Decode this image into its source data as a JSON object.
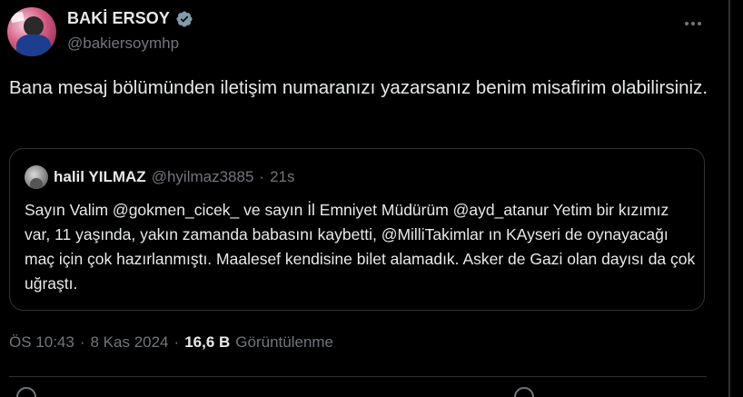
{
  "author": {
    "display_name": "BAKİ ERSOY",
    "handle": "@bakiersoymhp",
    "verified": true
  },
  "tweet": {
    "text": "Bana mesaj bölümünden iletişim numaranızı yazarsanız benim misafirim olabilirsiniz."
  },
  "quoted_tweet": {
    "display_name": "halil YILMAZ",
    "handle": "@hyilmaz3885",
    "separator": "·",
    "time_ago": "21s",
    "text": "Sayın Valim @gokmen_cicek_  ve sayın İl Emniyet Müdürüm @ayd_atanur Yetim bir kızımız var, 11 yaşında, yakın zamanda babasını kaybetti, @MilliTakimlar ın KAyseri de oynayacağı maç için çok hazırlanmıştı. Maalesef kendisine bilet alamadık. Asker de Gazi olan dayısı da çok uğraştı."
  },
  "meta": {
    "time": "ÖS 10:43",
    "separator1": "·",
    "date": "8 Kas 2024",
    "separator2": "·",
    "views_count": "16,6 B",
    "views_label": "Görüntülenme"
  },
  "colors": {
    "background": "#000000",
    "text_primary": "#e7e9ea",
    "text_secondary": "#71767b",
    "border": "#2f3336",
    "verified_badge": "#829aab"
  },
  "icons": {
    "verified": "verified-badge-icon",
    "more": "more-horizontal-icon"
  }
}
